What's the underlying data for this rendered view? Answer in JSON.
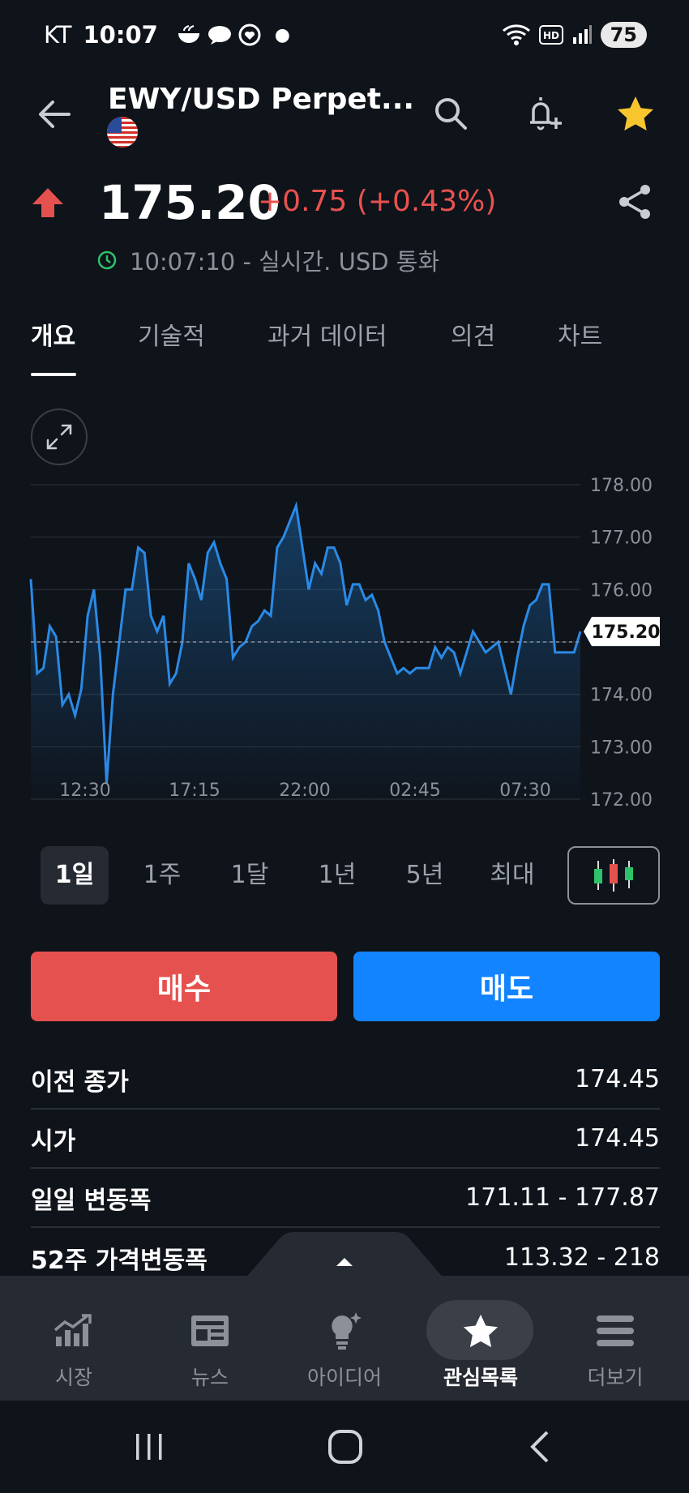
{
  "status_bar": {
    "carrier": "KT",
    "time": "10:07",
    "battery": "75"
  },
  "header": {
    "title": "EWY/USD Perpet...",
    "flag": "us-flag"
  },
  "quote": {
    "price": "175.20",
    "change": "+0.75 (+0.43%)",
    "direction": "up",
    "timestamp": "10:07:10 - 실시간. USD 통화"
  },
  "tabs": [
    {
      "label": "개요",
      "active": true
    },
    {
      "label": "기술적",
      "active": false
    },
    {
      "label": "과거 데이터",
      "active": false
    },
    {
      "label": "의견",
      "active": false
    },
    {
      "label": "차트",
      "active": false
    }
  ],
  "chart_data": {
    "type": "area",
    "x_tick_labels": [
      "12:30",
      "17:15",
      "22:00",
      "02:45",
      "07:30"
    ],
    "y_tick_labels": [
      "178.00",
      "177.00",
      "176.00",
      "174.00",
      "173.00",
      "172.00"
    ],
    "ylim": [
      172,
      178
    ],
    "previous_close": 175.0,
    "current_label": "175.20",
    "values": [
      176.2,
      174.4,
      174.5,
      175.3,
      175.1,
      173.8,
      174.0,
      173.6,
      174.1,
      175.5,
      176.0,
      174.7,
      172.3,
      174.0,
      175.0,
      176.0,
      176.0,
      176.8,
      176.7,
      175.5,
      175.2,
      175.5,
      174.2,
      174.4,
      175.0,
      176.5,
      176.2,
      175.8,
      176.7,
      176.9,
      176.5,
      176.2,
      174.7,
      174.9,
      175.0,
      175.3,
      175.4,
      175.6,
      175.5,
      176.8,
      177.0,
      177.3,
      177.6,
      176.8,
      176.0,
      176.5,
      176.3,
      176.8,
      176.8,
      176.5,
      175.7,
      176.1,
      176.1,
      175.8,
      175.9,
      175.6,
      175.0,
      174.7,
      174.4,
      174.5,
      174.4,
      174.5,
      174.5,
      174.5,
      174.9,
      174.7,
      174.9,
      174.8,
      174.4,
      174.8,
      175.2,
      175.0,
      174.8,
      174.9,
      175.0,
      174.5,
      174.0,
      174.7,
      175.3,
      175.7,
      175.8,
      176.1,
      176.1,
      174.8,
      174.8,
      174.8,
      174.8,
      175.2
    ]
  },
  "periods": [
    {
      "label": "1일",
      "active": true
    },
    {
      "label": "1주",
      "active": false
    },
    {
      "label": "1달",
      "active": false
    },
    {
      "label": "1년",
      "active": false
    },
    {
      "label": "5년",
      "active": false
    },
    {
      "label": "최대",
      "active": false
    }
  ],
  "actions": {
    "buy": "매수",
    "sell": "매도",
    "buy_color": "#e5514e",
    "sell_color": "#1384ff"
  },
  "stats": [
    {
      "label": "이전 종가",
      "value": "174.45"
    },
    {
      "label": "시가",
      "value": "174.45"
    },
    {
      "label": "일일 변동폭",
      "value": "171.11 - 177.87"
    },
    {
      "label": "52주 가격변동폭",
      "value": "113.32 - 218"
    }
  ],
  "bottom_nav": [
    {
      "label": "시장",
      "icon": "chart-growth-icon",
      "active": false
    },
    {
      "label": "뉴스",
      "icon": "newspaper-icon",
      "active": false
    },
    {
      "label": "아이디어",
      "icon": "lightbulb-icon",
      "active": false
    },
    {
      "label": "관심목록",
      "icon": "star-icon",
      "active": true
    },
    {
      "label": "더보기",
      "icon": "menu-icon",
      "active": false
    }
  ]
}
